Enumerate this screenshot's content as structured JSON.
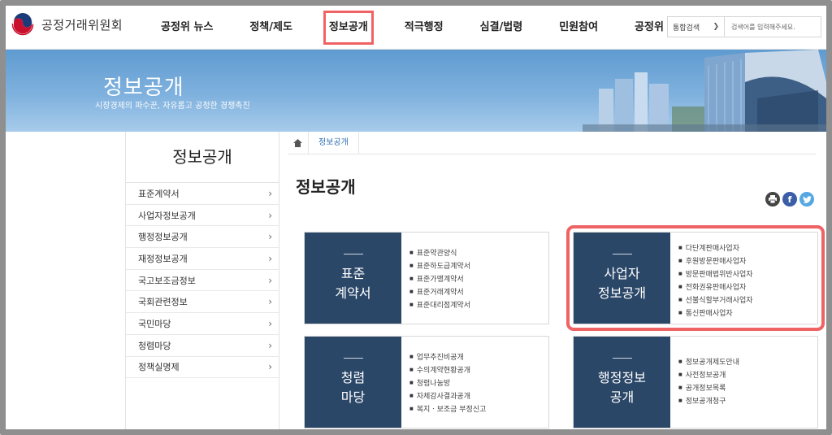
{
  "header": {
    "logo_text": "공정거래위원회",
    "nav": [
      {
        "label": "공정위 뉴스"
      },
      {
        "label": "정책/제도"
      },
      {
        "label": "정보공개"
      },
      {
        "label": "적극행정"
      },
      {
        "label": "심결/법령"
      },
      {
        "label": "민원참여"
      },
      {
        "label": "공정위 소개"
      }
    ],
    "highlighted_nav": "정보공개",
    "search": {
      "select_value": "통합검색",
      "placeholder": "검색어를 입력해주세요."
    }
  },
  "banner": {
    "title": "정보공개",
    "subtitle": "시장경제의 파수꾼, 자유롭고 공정한 경쟁촉진"
  },
  "sidebar": {
    "title": "정보공개",
    "items": [
      {
        "label": "표준계약서"
      },
      {
        "label": "사업자정보공개"
      },
      {
        "label": "행정정보공개"
      },
      {
        "label": "재정정보공개"
      },
      {
        "label": "국고보조금정보"
      },
      {
        "label": "국회관련정보"
      },
      {
        "label": "국민마당"
      },
      {
        "label": "청렴마당"
      },
      {
        "label": "정책실명제"
      }
    ]
  },
  "breadcrumb": {
    "current": "정보공개"
  },
  "main": {
    "title": "정보공개",
    "cards": [
      {
        "title_line1": "표준",
        "title_line2": "계약서",
        "highlighted": false,
        "links": [
          "표준약관양식",
          "표준하도급계약서",
          "표준가맹계약서",
          "표준거래계약서",
          "표준대리점계약서"
        ]
      },
      {
        "title_line1": "사업자",
        "title_line2": "정보공개",
        "highlighted": true,
        "links": [
          "다단계판매사업자",
          "후원방문판매사업자",
          "방문판매법위반사업자",
          "전화권유판매사업자",
          "선불식할부거래사업자",
          "통신판매사업자"
        ]
      },
      {
        "title_line1": "청렴",
        "title_line2": "마당",
        "highlighted": false,
        "links": [
          "업무추진비공개",
          "수의계약현황공개",
          "청렴나눔방",
          "자체감사결과공개",
          "복지ㆍ보조금 부정신고"
        ]
      },
      {
        "title_line1": "행정정보",
        "title_line2": "공개",
        "highlighted": false,
        "links": [
          "정보공개제도안내",
          "사전정보공개",
          "공개정보목록",
          "정보공개청구"
        ]
      }
    ]
  },
  "colors": {
    "card_head_bg": "#2b4768",
    "highlight": "#f06365",
    "banner_blue": "#6ea6d8",
    "link_blue": "#2c6eb5"
  },
  "icons": {
    "logo": "taegeuk-logo-icon",
    "home": "home-icon",
    "print": "print-icon",
    "facebook": "facebook-icon",
    "twitter": "twitter-icon",
    "chevron": "chevron-right-icon"
  }
}
